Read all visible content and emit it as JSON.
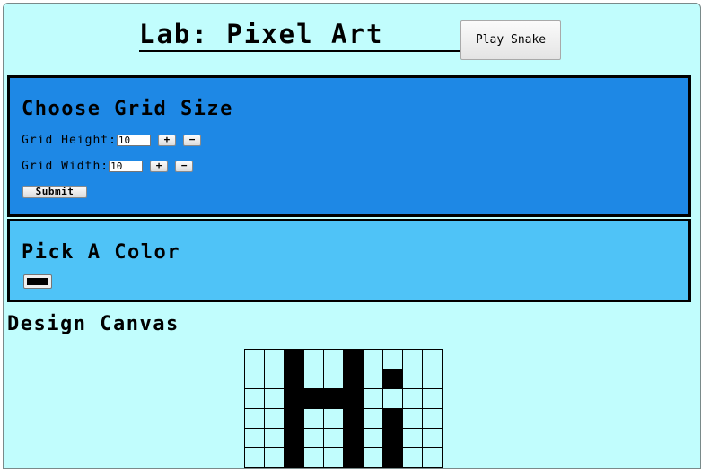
{
  "header": {
    "title": "Lab: Pixel Art",
    "play_snake_label": "Play Snake"
  },
  "grid_size_panel": {
    "heading": "Choose Grid Size",
    "height_label": "Grid Height:",
    "height_value": "10",
    "width_label": "Grid Width:",
    "width_value": "10",
    "plus_label": "+",
    "minus_label": "−",
    "submit_label": "Submit"
  },
  "color_panel": {
    "heading": "Pick A Color",
    "selected_color": "#000000"
  },
  "canvas": {
    "heading": "Design Canvas",
    "background_color": "#c1fdfd",
    "fill_color": "#000000",
    "rows": 10,
    "cols": 10,
    "visible_rows": 6,
    "filled_cells": [
      [
        0,
        2
      ],
      [
        0,
        5
      ],
      [
        1,
        2
      ],
      [
        1,
        5
      ],
      [
        1,
        7
      ],
      [
        2,
        2
      ],
      [
        2,
        3
      ],
      [
        2,
        4
      ],
      [
        2,
        5
      ],
      [
        3,
        2
      ],
      [
        3,
        5
      ],
      [
        3,
        7
      ],
      [
        4,
        2
      ],
      [
        4,
        5
      ],
      [
        4,
        7
      ],
      [
        5,
        2
      ],
      [
        5,
        5
      ],
      [
        5,
        7
      ]
    ]
  }
}
